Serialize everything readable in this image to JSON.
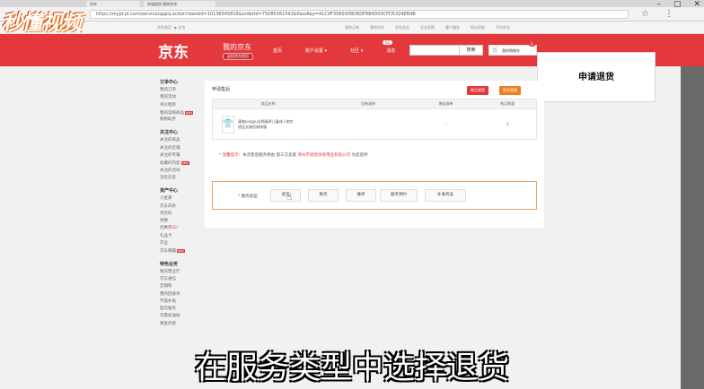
{
  "watermark": "秒懂视频",
  "browser": {
    "tabs": [
      "京东",
      "申请退货-我的京东"
    ],
    "url": "https://myjd.jd.com/service/apply.action?wareId=10136545816&orderId=75085361542&PassKey=41C0F3560008D8DF884D00CFD5324EB4B",
    "star_icon": "star-icon",
    "menu_icon": "menu-icon"
  },
  "topbar": {
    "home": "京东首页",
    "location": "北京",
    "links": [
      "我的订单",
      "我的京东",
      "京东会员",
      "企业采购",
      "客户服务",
      "网站导航",
      "手机京东"
    ]
  },
  "header": {
    "logo": "京东",
    "my_jd": "我的京东",
    "home_button": "返回京东首页",
    "nav": [
      "首页",
      "账户设置 ▾",
      "社区 ▾",
      "消息"
    ],
    "msg_count": "62",
    "search_button": "搜索",
    "cart_label": "我的购物车",
    "cart_count": "0"
  },
  "callout": "申请退货",
  "sidebar": [
    {
      "title": "订单中心",
      "items": [
        {
          "label": "我的订单"
        },
        {
          "label": "我的活动"
        },
        {
          "label": "评价晒单"
        },
        {
          "label": "我的常购商品",
          "badge": "NEW"
        },
        {
          "label": "购物助手"
        }
      ]
    },
    {
      "title": "关注中心",
      "items": [
        {
          "label": "关注的商品"
        },
        {
          "label": "关注的店铺"
        },
        {
          "label": "关注的专辑"
        },
        {
          "label": "收藏的内容",
          "badge": "NEW"
        },
        {
          "label": "关注的活动"
        },
        {
          "label": "浏览历史"
        }
      ]
    },
    {
      "title": "资产中心",
      "items": [
        {
          "label": "小金库"
        },
        {
          "label": "京东白条"
        },
        {
          "label": "领货码"
        },
        {
          "label": "余额"
        },
        {
          "label": "优惠券",
          "count": "(5)"
        },
        {
          "label": "礼品卡"
        },
        {
          "label": "京豆"
        },
        {
          "label": "京东钢镚",
          "badge": "NEW"
        }
      ]
    },
    {
      "title": "特色业务",
      "items": [
        {
          "label": "我的营业厅"
        },
        {
          "label": "京东通信"
        },
        {
          "label": "定期购"
        },
        {
          "label": "我的回收单"
        },
        {
          "label": "节能补贴"
        },
        {
          "label": "医药服务"
        },
        {
          "label": "流量加油站"
        },
        {
          "label": "黄金托管"
        }
      ]
    }
  ],
  "content": {
    "title": "申请售后",
    "btn_policy": "售后政策",
    "btn_contact": "联系客服",
    "columns": [
      "商品名称",
      "包装清单",
      "赠送清单",
      "购买数量"
    ],
    "product": {
      "name": "康婉pingpu全棉春季儿童成人跑步透层长袖短袖袜服",
      "packing": "",
      "gift": "-",
      "qty": "1"
    },
    "notice_label": "* 温馨提示：",
    "notice_text": "本次售后服务将由 第三方卖家",
    "notice_vendor": "青州市恩智体育用品有限公司",
    "notice_tail": "为您提供",
    "service_label": "* 服务类型：",
    "services": [
      "退货",
      "换货",
      "维修",
      "服务预约",
      "补发商品"
    ]
  },
  "subtitle": "在服务类型中选择退货"
}
